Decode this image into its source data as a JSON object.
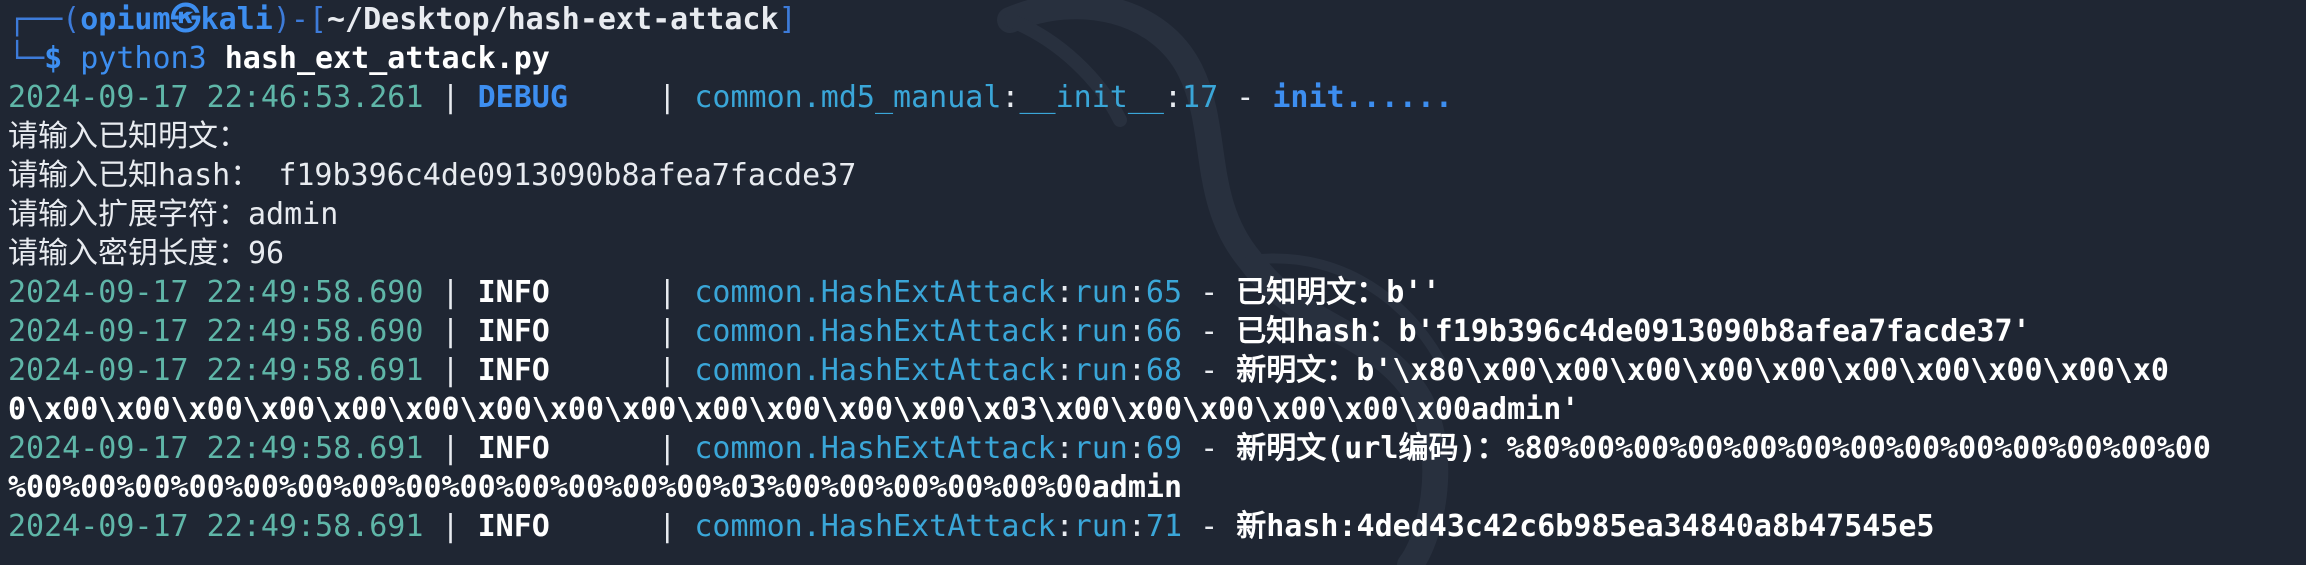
{
  "prompt": {
    "user": "opium",
    "at_symbol": "㉿",
    "host": "kali",
    "path": "~/Desktop/hash-ext-attack",
    "dollar": "$",
    "command": "python3",
    "argument": "hash_ext_attack.py"
  },
  "debug_line": {
    "timestamp": "2024-09-17 22:46:53.261",
    "level": "DEBUG",
    "module": "common.md5_manual",
    "function": "__init__",
    "line_no": "17",
    "message": "init......"
  },
  "inputs": [
    {
      "label": "请输入已知明文：",
      "value": ""
    },
    {
      "label": "请输入已知hash： ",
      "value": "f19b396c4de0913090b8afea7facde37"
    },
    {
      "label": "请输入扩展字符：",
      "value": "admin"
    },
    {
      "label": "请输入密钥长度：",
      "value": "96"
    }
  ],
  "info_lines": [
    {
      "timestamp": "2024-09-17 22:49:58.690",
      "level": "INFO",
      "module": "common.HashExtAttack",
      "function": "run",
      "line_no": "65",
      "message": "已知明文：b''",
      "continuation": ""
    },
    {
      "timestamp": "2024-09-17 22:49:58.690",
      "level": "INFO",
      "module": "common.HashExtAttack",
      "function": "run",
      "line_no": "66",
      "message": "已知hash：b'f19b396c4de0913090b8afea7facde37'",
      "continuation": ""
    },
    {
      "timestamp": "2024-09-17 22:49:58.691",
      "level": "INFO",
      "module": "common.HashExtAttack",
      "function": "run",
      "line_no": "68",
      "message": "新明文：b'\\x80\\x00\\x00\\x00\\x00\\x00\\x00\\x00\\x00\\x00\\x0",
      "continuation": "0\\x00\\x00\\x00\\x00\\x00\\x00\\x00\\x00\\x00\\x00\\x00\\x00\\x00\\x03\\x00\\x00\\x00\\x00\\x00\\x00admin'"
    },
    {
      "timestamp": "2024-09-17 22:49:58.691",
      "level": "INFO",
      "module": "common.HashExtAttack",
      "function": "run",
      "line_no": "69",
      "message": "新明文(url编码)：%80%00%00%00%00%00%00%00%00%00%00%00%00",
      "continuation": "%00%00%00%00%00%00%00%00%00%00%00%00%00%03%00%00%00%00%00%00admin"
    },
    {
      "timestamp": "2024-09-17 22:49:58.691",
      "level": "INFO",
      "module": "common.HashExtAttack",
      "function": "run",
      "line_no": "71",
      "message": "新hash:4ded43c42c6b985ea34840a8b47545e5",
      "continuation": ""
    }
  ],
  "separator": " | ",
  "dash": " - ",
  "colors": {
    "background": "#1f2633",
    "accent_blue": "#3d8ef0",
    "timestamp_teal": "#5fb6a8",
    "module_blue": "#3aa6d8",
    "text": "#e8ebf0"
  }
}
